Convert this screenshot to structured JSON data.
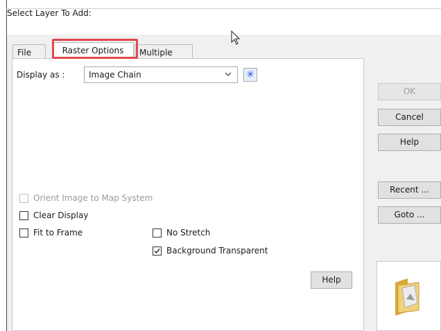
{
  "window": {
    "title": "Select Layer To Add:"
  },
  "tabs": [
    {
      "label": "File",
      "active": false
    },
    {
      "label": "Raster Options",
      "active": true
    },
    {
      "label": "Multiple",
      "active": false
    }
  ],
  "raster": {
    "display_label": "Display as :",
    "display_value": "Image Chain",
    "asterisk": "✳",
    "orient": {
      "label": "Orient Image to Map System",
      "checked": false,
      "enabled": false
    },
    "clear_display": {
      "label": "Clear Display",
      "checked": false
    },
    "fit_to_frame": {
      "label": "Fit to Frame",
      "checked": false
    },
    "no_stretch": {
      "label": "No Stretch",
      "checked": false
    },
    "background_transparent": {
      "label": "Background Transparent",
      "checked": true
    },
    "help_label": "Help"
  },
  "side_buttons": {
    "ok": "OK",
    "cancel": "Cancel",
    "help": "Help",
    "recent": "Recent ...",
    "goto": "Goto ..."
  },
  "colors": {
    "highlight": "#e0474c",
    "folder": "#e8c04a"
  }
}
